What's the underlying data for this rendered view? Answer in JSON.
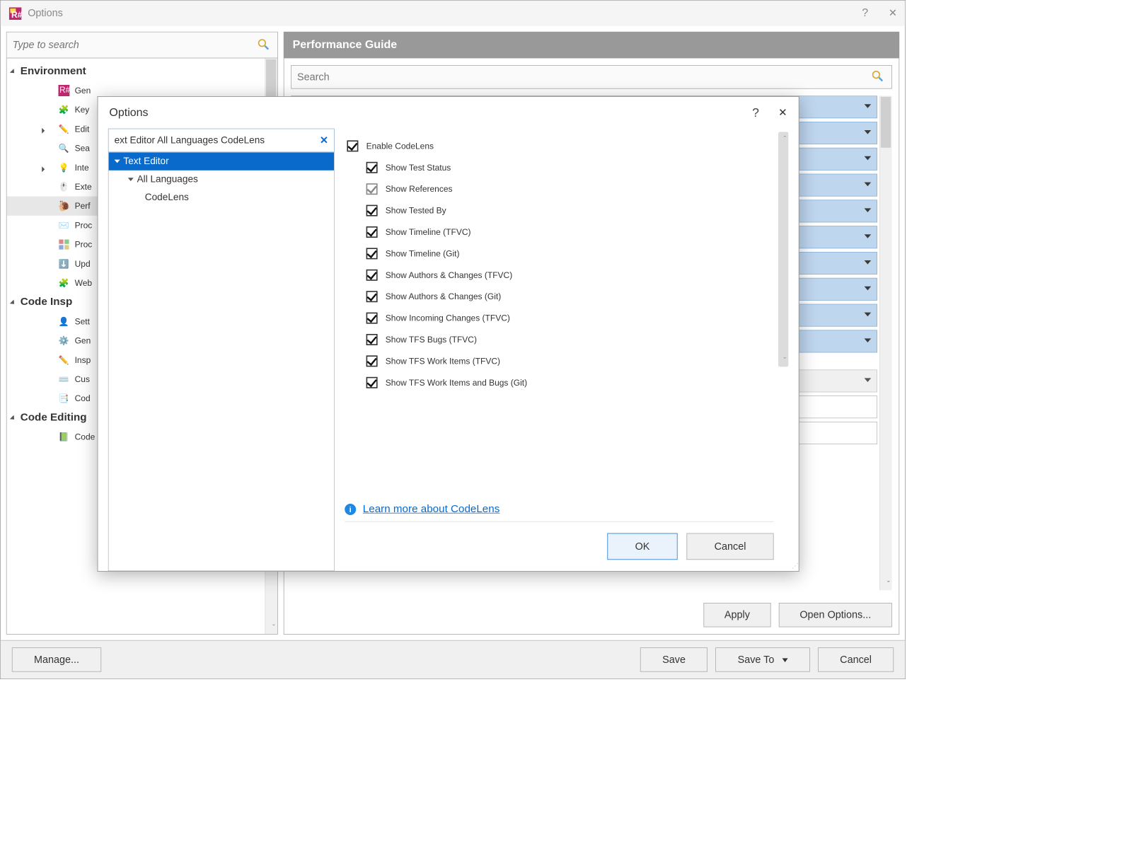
{
  "titlebar": {
    "title": "Options",
    "help": "?",
    "close": "✕"
  },
  "left_search": {
    "placeholder": "Type to search"
  },
  "tree": {
    "cat1": "Environment",
    "items1": [
      "Gen",
      "Key",
      "Edit",
      "Sea",
      "Inte",
      "Exte",
      "Perf",
      "Proc",
      "Proc",
      "Upd",
      "Web"
    ],
    "cat2": "Code Insp",
    "items2": [
      "Sett",
      "Gen",
      "Insp",
      "Cus",
      "Cod"
    ],
    "cat3": "Code Editing",
    "items3": [
      "Code Style Sharing"
    ]
  },
  "perf": {
    "header": "Performance Guide",
    "search_placeholder": "Search",
    "apply": "Apply",
    "open_options": "Open Options..."
  },
  "footer": {
    "manage": "Manage...",
    "save": "Save",
    "save_to": "Save To",
    "cancel": "Cancel"
  },
  "modal": {
    "title": "Options",
    "help": "?",
    "close": "✕",
    "search_text": "ext Editor All Languages CodeLens",
    "search_x": "✕",
    "tree": {
      "n0": "Text Editor",
      "n1": "All Languages",
      "n2": "CodeLens"
    },
    "opts": [
      {
        "label": "Enable CodeLens",
        "checked": true,
        "indent": 0
      },
      {
        "label": "Show Test Status",
        "checked": true,
        "indent": 1
      },
      {
        "label": "Show References",
        "checked": true,
        "indent": 1,
        "grey": true
      },
      {
        "label": "Show Tested By",
        "checked": true,
        "indent": 1
      },
      {
        "label": "Show Timeline (TFVC)",
        "checked": true,
        "indent": 1
      },
      {
        "label": "Show Timeline (Git)",
        "checked": true,
        "indent": 1
      },
      {
        "label": "Show Authors & Changes (TFVC)",
        "checked": true,
        "indent": 1
      },
      {
        "label": "Show Authors & Changes (Git)",
        "checked": true,
        "indent": 1
      },
      {
        "label": "Show Incoming Changes (TFVC)",
        "checked": true,
        "indent": 1
      },
      {
        "label": "Show TFS Bugs (TFVC)",
        "checked": true,
        "indent": 1
      },
      {
        "label": "Show TFS Work Items (TFVC)",
        "checked": true,
        "indent": 1
      },
      {
        "label": "Show TFS Work Items and Bugs (Git)",
        "checked": true,
        "indent": 1
      }
    ],
    "link": "Learn more about CodeLens",
    "ok": "OK",
    "cancel": "Cancel"
  }
}
